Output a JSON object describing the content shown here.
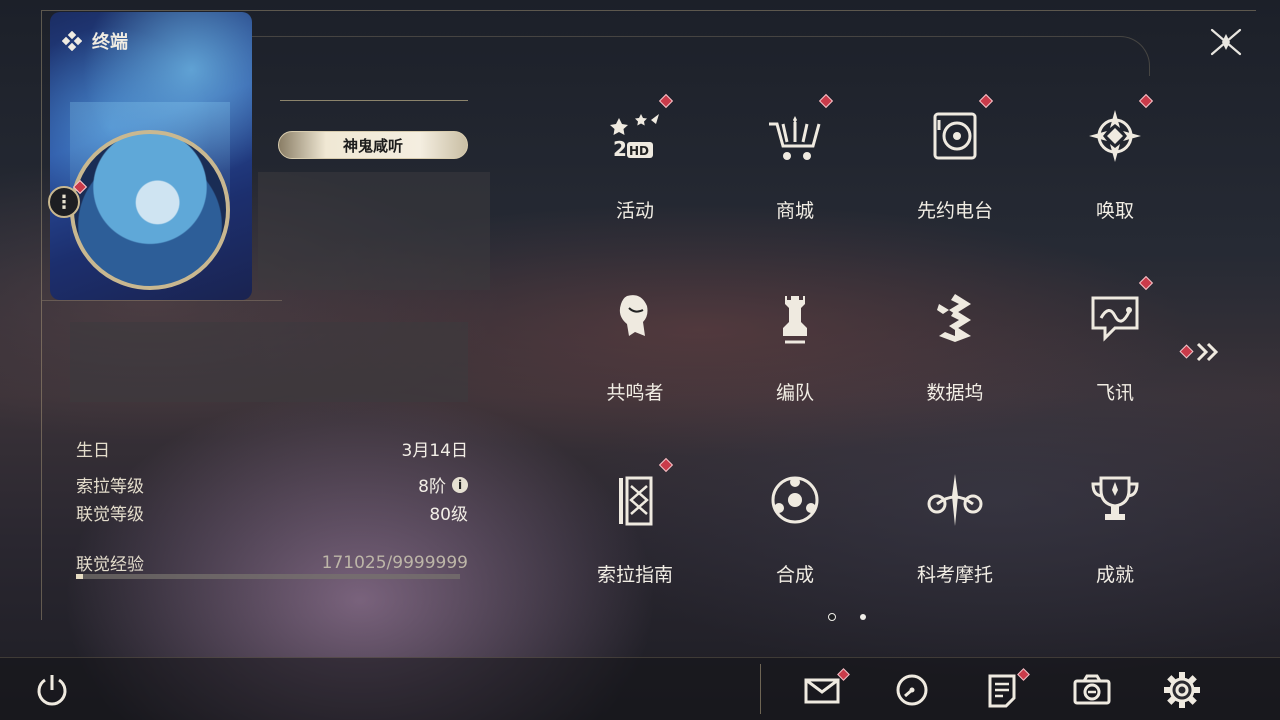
{
  "terminal": {
    "title": "终端"
  },
  "profile": {
    "name": "神鬼咸听",
    "stats": [
      {
        "label": "生日",
        "value": "3月14日"
      },
      {
        "label": "索拉等级",
        "value": "8阶",
        "info": "i"
      },
      {
        "label": "联觉等级",
        "value": "80级"
      }
    ],
    "experience": {
      "label": "联觉经验",
      "value": "171025/9999999",
      "progress": 0.0171
    },
    "more_label": "⋮"
  },
  "menu": [
    {
      "label": "活动",
      "icon": "event-2hd-icon",
      "badge": true
    },
    {
      "label": "商城",
      "icon": "shop-cart-icon",
      "badge": true
    },
    {
      "label": "先约电台",
      "icon": "radio-record-icon",
      "badge": true
    },
    {
      "label": "唤取",
      "icon": "compass-summon-icon",
      "badge": true
    },
    {
      "label": "共鸣者",
      "icon": "resonator-head-icon",
      "badge": false
    },
    {
      "label": "编队",
      "icon": "chess-team-icon",
      "badge": false
    },
    {
      "label": "数据坞",
      "icon": "data-dock-icon",
      "badge": false
    },
    {
      "label": "飞讯",
      "icon": "chat-bubble-icon",
      "badge": true
    },
    {
      "label": "索拉指南",
      "icon": "guidebook-icon",
      "badge": true
    },
    {
      "label": "合成",
      "icon": "synthesis-icon",
      "badge": false
    },
    {
      "label": "科考摩托",
      "icon": "motorbike-icon",
      "badge": false
    },
    {
      "label": "成就",
      "icon": "trophy-icon",
      "badge": false
    }
  ],
  "pagination": {
    "current": 1,
    "total": 2
  },
  "bottom_bar": [
    {
      "icon": "mail-icon",
      "badge": true
    },
    {
      "icon": "clock-icon",
      "badge": false
    },
    {
      "icon": "notice-icon",
      "badge": true
    },
    {
      "icon": "camera-icon",
      "badge": false
    },
    {
      "icon": "gear-icon",
      "badge": false
    }
  ],
  "colors": {
    "accent_gold": "#c9b890",
    "badge_red": "#c93b4a",
    "text": "#f1ede4"
  }
}
